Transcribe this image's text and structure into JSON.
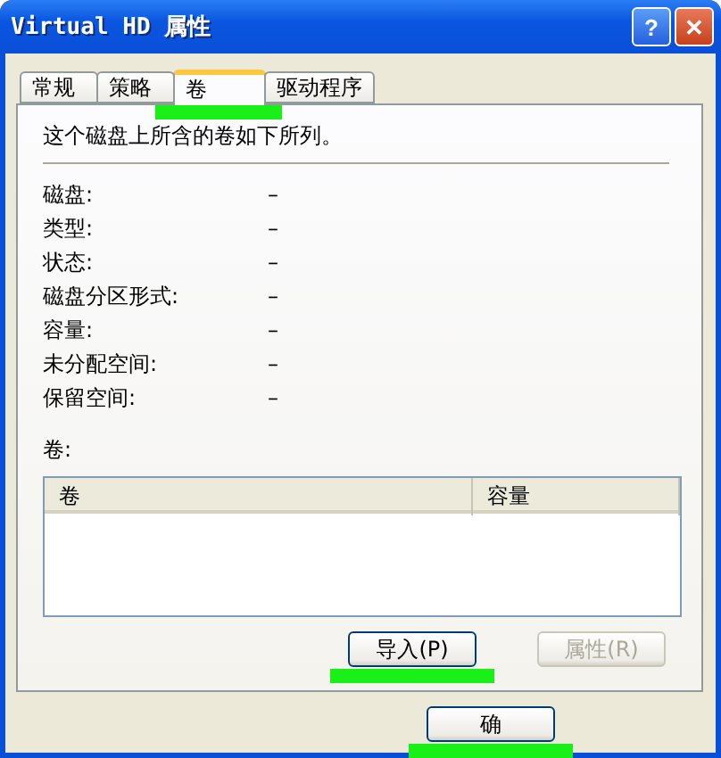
{
  "window": {
    "title": "Virtual HD 属性"
  },
  "title_buttons": [
    {
      "kind": "help",
      "label": "?"
    },
    {
      "kind": "close",
      "label": "✕"
    }
  ],
  "tabs": [
    {
      "label": "常规",
      "selected": false,
      "highlighted": false
    },
    {
      "label": "策略",
      "selected": false,
      "highlighted": false
    },
    {
      "label": "卷",
      "selected": true,
      "highlighted": true
    },
    {
      "label": "驱动程序",
      "selected": false,
      "highlighted": false
    }
  ],
  "intro": "这个磁盘上所含的卷如下所列。",
  "fields": [
    {
      "label": "磁盘:",
      "value": "–"
    },
    {
      "label": "类型:",
      "value": "–"
    },
    {
      "label": "状态:",
      "value": "–"
    },
    {
      "label": "磁盘分区形式:",
      "value": "–"
    },
    {
      "label": "容量:",
      "value": "–"
    },
    {
      "label": "未分配空间:",
      "value": "–"
    },
    {
      "label": "保留空间:",
      "value": "–"
    }
  ],
  "volumes": {
    "label": "卷:",
    "columns": [
      "卷",
      "容量"
    ]
  },
  "panel_buttons": [
    {
      "label": "导入(P)",
      "disabled": false,
      "highlighted": true
    },
    {
      "label": "属性(R)",
      "disabled": true,
      "highlighted": false
    }
  ],
  "dialog_buttons": [
    {
      "label": "确",
      "disabled": false,
      "highlighted": true
    }
  ]
}
